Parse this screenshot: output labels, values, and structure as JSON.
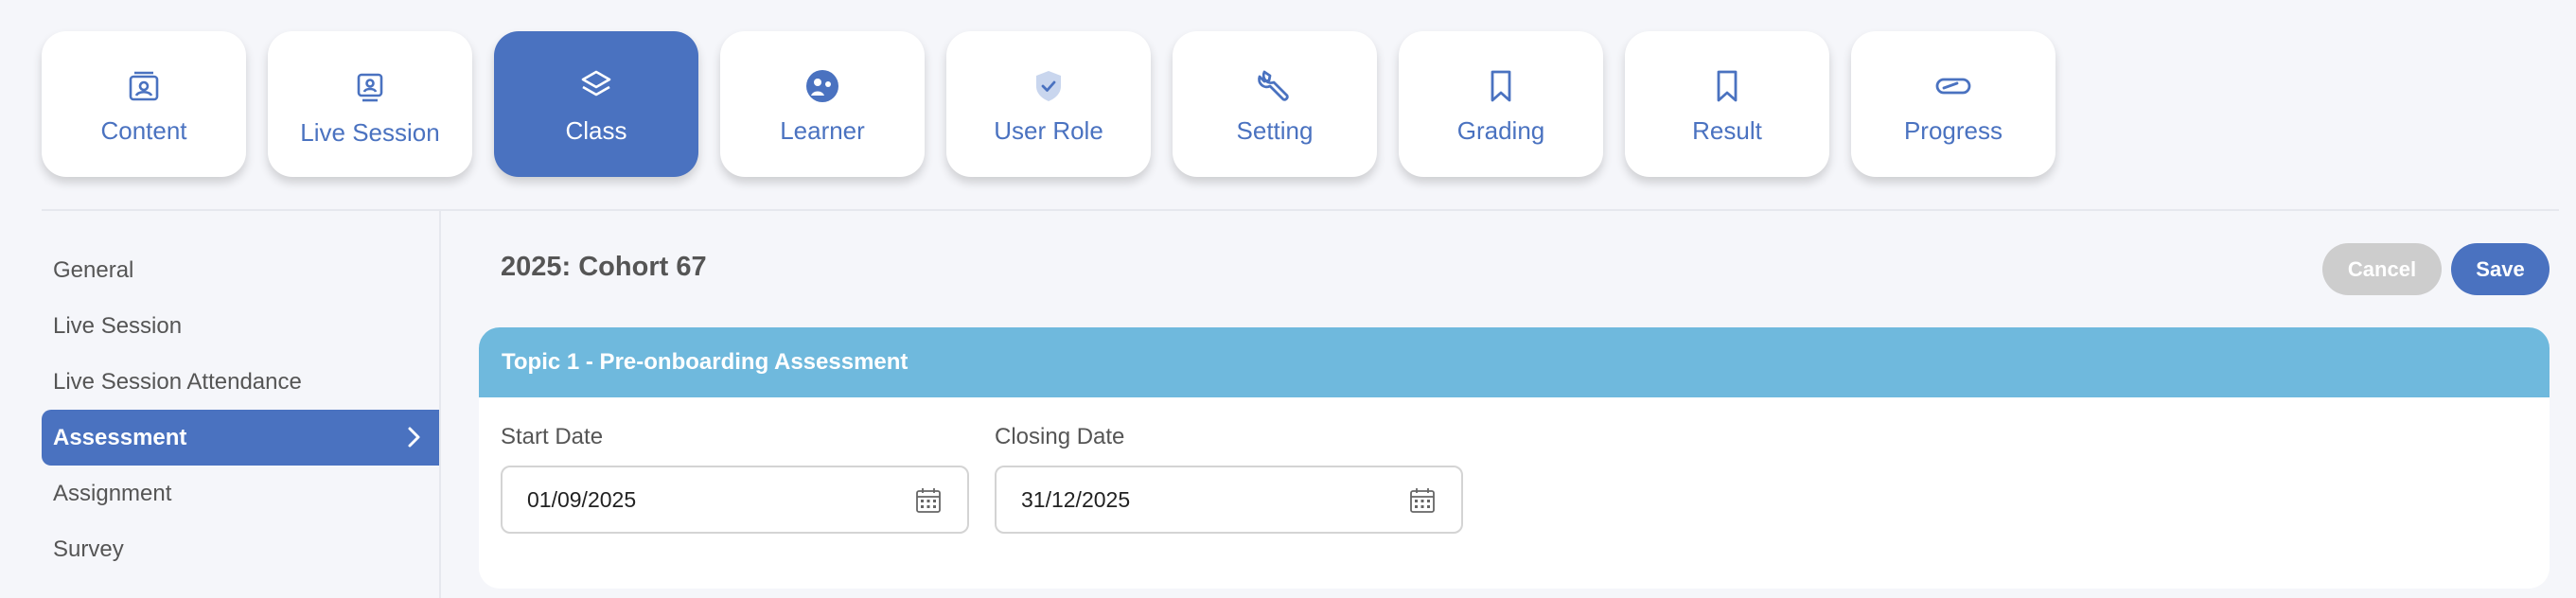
{
  "tabs": [
    {
      "label": "Content",
      "icon": "content-icon",
      "active": false
    },
    {
      "label": "Live Session",
      "icon": "live-session-icon",
      "active": false
    },
    {
      "label": "Class",
      "icon": "layers-icon",
      "active": true
    },
    {
      "label": "Learner",
      "icon": "learner-icon",
      "active": false
    },
    {
      "label": "User Role",
      "icon": "shield-check-icon",
      "active": false
    },
    {
      "label": "Setting",
      "icon": "wrench-icon",
      "active": false
    },
    {
      "label": "Grading",
      "icon": "bookmark-icon",
      "active": false
    },
    {
      "label": "Result",
      "icon": "bookmark-icon",
      "active": false
    },
    {
      "label": "Progress",
      "icon": "progress-icon",
      "active": false
    }
  ],
  "sidebar": {
    "items": [
      {
        "label": "General",
        "active": false
      },
      {
        "label": "Live Session",
        "active": false
      },
      {
        "label": "Live Session Attendance",
        "active": false
      },
      {
        "label": "Assessment",
        "active": true
      },
      {
        "label": "Assignment",
        "active": false
      },
      {
        "label": "Survey",
        "active": false
      }
    ]
  },
  "main": {
    "title": "2025: Cohort 67",
    "cancel_label": "Cancel",
    "save_label": "Save",
    "topic": {
      "title": "Topic 1 - Pre-onboarding Assessment",
      "start_label": "Start Date",
      "start_value": "01/09/2025",
      "closing_label": "Closing Date",
      "closing_value": "31/12/2025"
    }
  },
  "colors": {
    "accent": "#4a72c0",
    "topic_header": "#6fb9dd",
    "cancel": "#cdcdcd",
    "background": "#f5f6fa"
  }
}
